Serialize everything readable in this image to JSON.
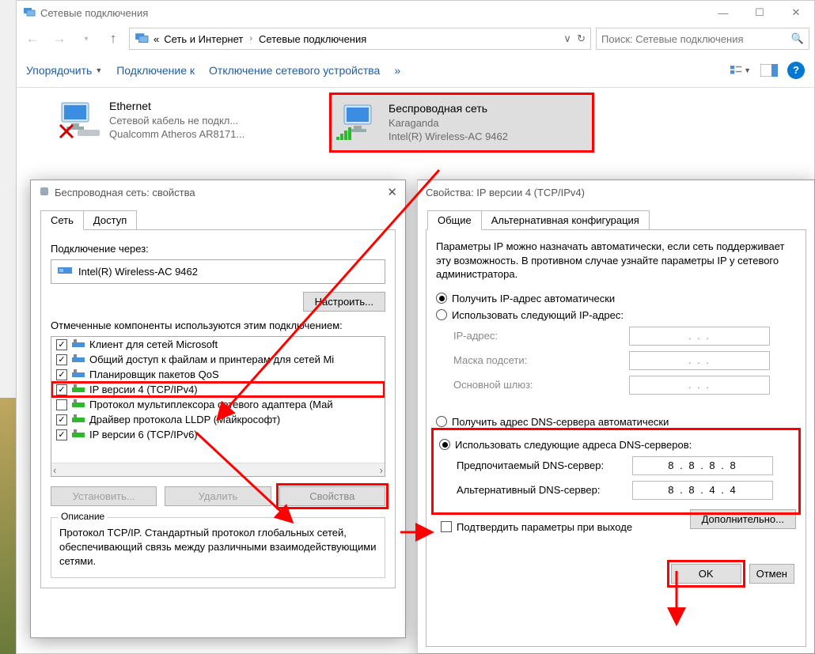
{
  "explorer": {
    "title": "Сетевые подключения",
    "breadcrumb": {
      "prefix": "«",
      "a": "Сеть и Интернет",
      "b": "Сетевые подключения"
    },
    "search_placeholder": "Поиск: Сетевые подключения",
    "toolbar": {
      "organize": "Упорядочить",
      "connect": "Подключение к",
      "disable": "Отключение сетевого устройства",
      "more": "»"
    }
  },
  "connections": {
    "eth": {
      "name": "Ethernet",
      "status": "Сетевой кабель не подкл...",
      "device": "Qualcomm Atheros AR8171..."
    },
    "wifi": {
      "name": "Беспроводная сеть",
      "status": "Karaganda",
      "device": "Intel(R) Wireless-AC 9462"
    }
  },
  "props_dialog": {
    "title": "Беспроводная сеть: свойства",
    "tabs": {
      "net": "Сеть",
      "access": "Доступ"
    },
    "connect_via": "Подключение через:",
    "adapter": "Intel(R) Wireless-AC 9462",
    "configure": "Настроить...",
    "components_label": "Отмеченные компоненты используются этим подключением:",
    "components": [
      {
        "checked": true,
        "label": "Клиент для сетей Microsoft"
      },
      {
        "checked": true,
        "label": "Общий доступ к файлам и принтерам для сетей Mi"
      },
      {
        "checked": true,
        "label": "Планировщик пакетов QoS"
      },
      {
        "checked": true,
        "label": "IP версии 4 (TCP/IPv4)"
      },
      {
        "checked": false,
        "label": "Протокол мультиплексора сетевого адаптера (Май"
      },
      {
        "checked": true,
        "label": "Драйвер протокола LLDP (Майкрософт)"
      },
      {
        "checked": true,
        "label": "IP версии 6 (TCP/IPv6)"
      }
    ],
    "install": "Установить...",
    "remove": "Удалить",
    "properties": "Свойства",
    "desc_legend": "Описание",
    "desc_text": "Протокол TCP/IP. Стандартный протокол глобальных сетей, обеспечивающий связь между различными взаимодействующими сетями."
  },
  "ipv4_dialog": {
    "title": "Свойства: IP версии 4 (TCP/IPv4)",
    "tabs": {
      "general": "Общие",
      "alt": "Альтернативная конфигурация"
    },
    "intro": "Параметры IP можно назначать автоматически, если сеть поддерживает эту возможность. В противном случае узнайте параметры IP у сетевого администратора.",
    "auto_ip": "Получить IP-адрес автоматически",
    "manual_ip": "Использовать следующий IP-адрес:",
    "ip_addr": "IP-адрес:",
    "mask": "Маска подсети:",
    "gateway": "Основной шлюз:",
    "auto_dns": "Получить адрес DNS-сервера автоматически",
    "manual_dns": "Использовать следующие адреса DNS-серверов:",
    "pref_dns": "Предпочитаемый DNS-сервер:",
    "alt_dns": "Альтернативный DNS-сервер:",
    "pref_val": "8 . 8 . 8 . 8",
    "alt_val": "8 . 8 . 4 . 4",
    "placeholder": ".       .       .",
    "confirm": "Подтвердить параметры при выходе",
    "advanced": "Дополнительно...",
    "ok": "OK",
    "cancel": "Отмен"
  }
}
